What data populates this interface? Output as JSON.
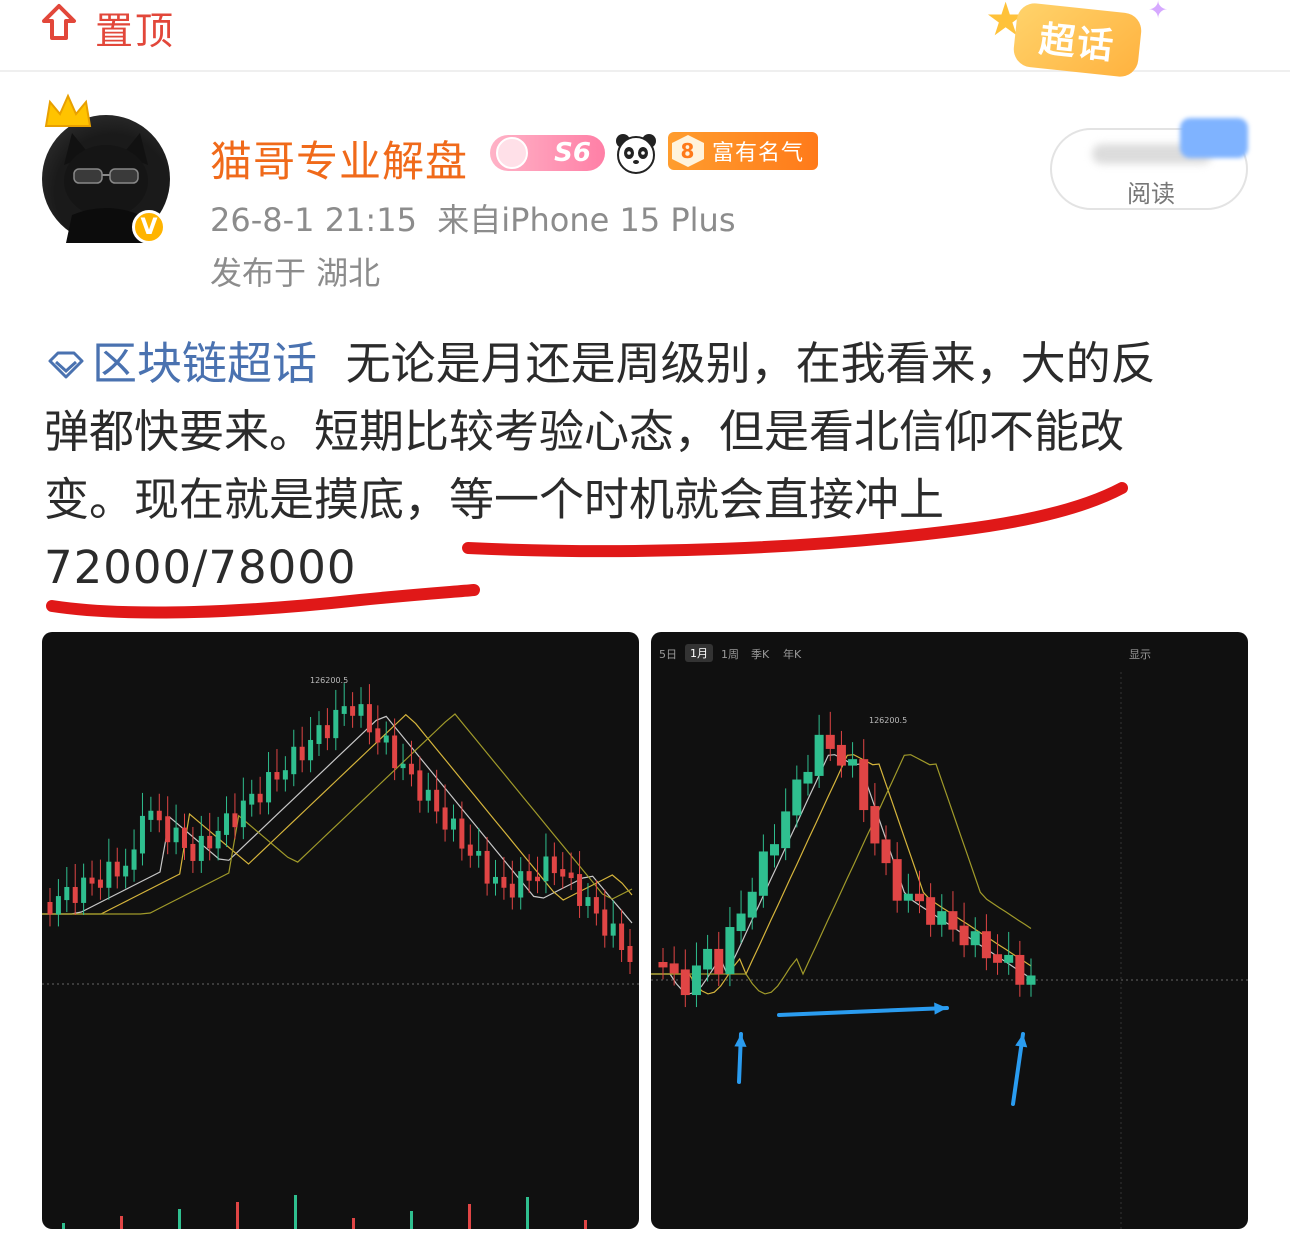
{
  "header": {
    "pin_label": "置顶",
    "chaohua_badge": "超话"
  },
  "author": {
    "name": "猫哥专业解盘",
    "level": "S6",
    "fame_level": "8",
    "fame_label": "富有名气",
    "verified_mark": "V"
  },
  "meta": {
    "time_source": "26-8-1 21:15  来自iPhone 15 Plus",
    "location": "发布于 湖北"
  },
  "read_button": {
    "label": "阅读"
  },
  "post": {
    "topic": "区块链超话",
    "body_line1": "  无论是月还是周级别，在我看来，大的反",
    "body_line2": "弹都快要来。短期比较考验心态，但是看北信仰不能改",
    "body_line3": "变。现在就是摸底，等一个时机就会直接冲上",
    "body_line4": "72000/78000"
  },
  "chart_left": {
    "peak_label": "126200.5"
  },
  "chart_right": {
    "tabs": [
      "5日",
      "1月",
      "1周",
      "季K",
      "年K"
    ],
    "peak_label": "126200.5",
    "tools": [
      "显示"
    ]
  },
  "colors": {
    "accent_orange": "#f06a1a",
    "pin_red": "#e2473a",
    "topic_blue": "#4a72b0",
    "candle_up": "#2fbf8f",
    "candle_down": "#e04545",
    "annotation_red": "#e01818",
    "annotation_blue": "#2a9cf0"
  }
}
